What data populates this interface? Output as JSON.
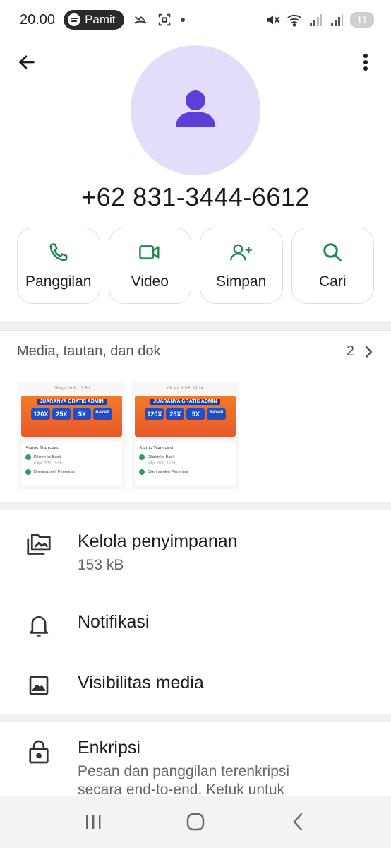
{
  "status_bar": {
    "time": "20.00",
    "media_app_label": "Pamit",
    "battery": "11",
    "icons": [
      "spotify-icon",
      "missed-call-icon",
      "screenshot-icon",
      "dot-icon",
      "mute-icon",
      "wifi-icon",
      "signal-icon",
      "signal-icon",
      "battery-icon"
    ]
  },
  "contact": {
    "phone_number": "+62 831-3444-6612"
  },
  "actions": [
    {
      "label": "Panggilan",
      "icon": "phone-icon"
    },
    {
      "label": "Video",
      "icon": "video-icon"
    },
    {
      "label": "Simpan",
      "icon": "add-person-icon"
    },
    {
      "label": "Cari",
      "icon": "search-icon"
    }
  ],
  "media": {
    "title": "Media, tautan, dan dok",
    "count": "2",
    "thumbnails": [
      {
        "date": "08 Apr 2026, 19:50",
        "headline": "JUARANYA GRATIS ADMIN",
        "tags": [
          "120X",
          "25X",
          "5X",
          "BAYAR"
        ],
        "status_title": "Status Transaksi",
        "step1": "Dikirim ke Bank",
        "step1_time": "8 Apr 2026, 19:50",
        "step2": "Diterima oleh Penerima"
      },
      {
        "date": "08 Apr 2026, 19:24",
        "headline": "JUARANYA GRATIS ADMIN",
        "tags": [
          "120X",
          "25X",
          "5X",
          "BAYAR"
        ],
        "status_title": "Status Transaksi",
        "step1": "Dikirim ke Bank",
        "step1_time": "8 Apr 2026, 19:24",
        "step2": "Diterima oleh Penerima"
      }
    ]
  },
  "settings": {
    "storage": {
      "title": "Kelola penyimpanan",
      "subtitle": "153 kB",
      "icon": "storage-icon"
    },
    "notifications": {
      "title": "Notifikasi",
      "icon": "bell-icon"
    },
    "media_visibility": {
      "title": "Visibilitas media",
      "icon": "image-icon"
    },
    "encryption": {
      "title": "Enkripsi",
      "subtitle": "Pesan dan panggilan terenkripsi secara end-to-end. Ketuk untuk",
      "icon": "lock-icon"
    }
  },
  "colors": {
    "accent_green": "#1f8a4c",
    "avatar_bg": "#e3dcfa",
    "avatar_fg": "#5b3fd6"
  }
}
